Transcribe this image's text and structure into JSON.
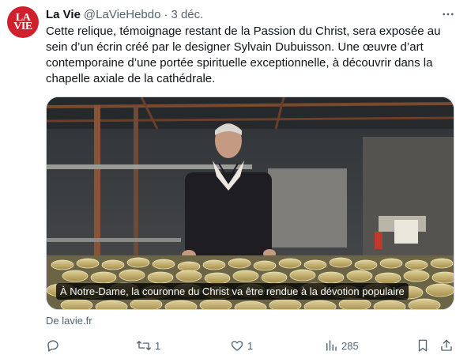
{
  "author": {
    "avatar_text": "LA VIE",
    "name": "La Vie",
    "handle": "@LaVieHebdo",
    "separator": "·",
    "time": "3 déc."
  },
  "tweet": {
    "text": "Cette relique, témoignage restant de la Passion du Christ, sera exposée au sein d’un écrin créé par le designer Sylvain Dubuisson. Une œuvre d’art contemporaine d’une portée spirituelle exceptionnelle, à découvrir dans la chapelle axiale de la cathédrale."
  },
  "card": {
    "caption": "À Notre-Dame, la couronne du Christ va être rendue à la dévotion populaire",
    "source": "De lavie.fr"
  },
  "actions": {
    "reply": {
      "icon": "reply-icon",
      "count": ""
    },
    "retweet": {
      "icon": "retweet-icon",
      "count": "1"
    },
    "like": {
      "icon": "heart-icon",
      "count": "1"
    },
    "views": {
      "icon": "views-icon",
      "count": "285"
    },
    "bookmark": {
      "icon": "bookmark-icon"
    },
    "share": {
      "icon": "share-icon"
    }
  },
  "colors": {
    "text": "#0f1419",
    "secondary": "#536471",
    "avatar_bg": "#d0202d",
    "border": "#cfd9de"
  }
}
